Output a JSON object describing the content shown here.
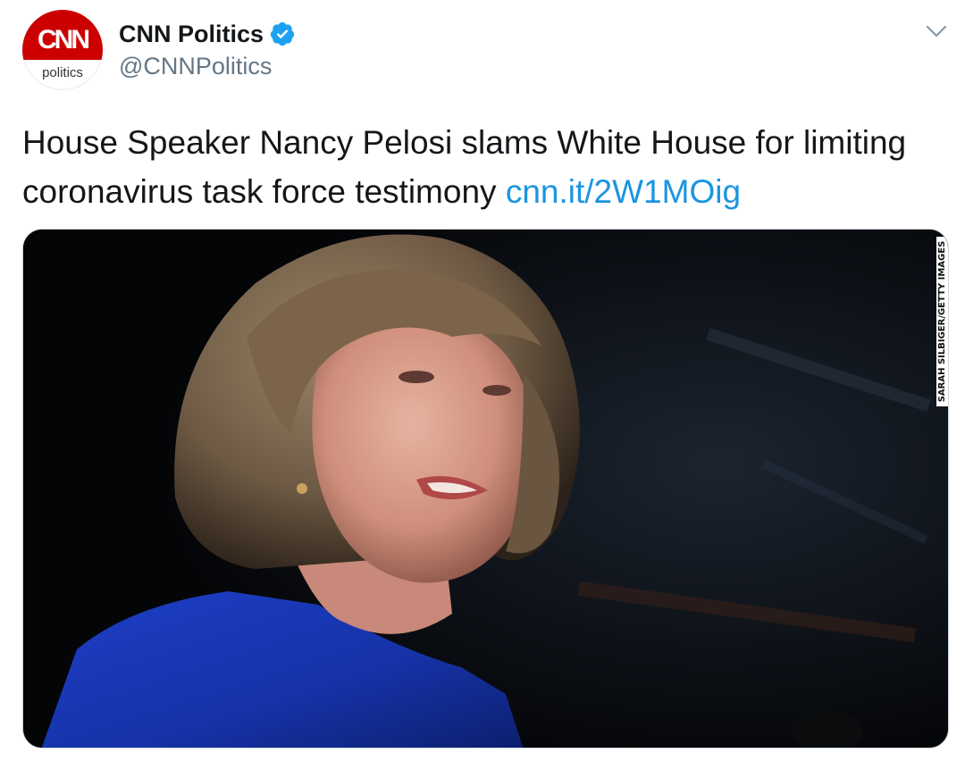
{
  "author": {
    "display_name": "CNN Politics",
    "handle": "@CNNPolitics",
    "verified": true,
    "avatar_logo": "CNN",
    "avatar_subtitle": "politics",
    "avatar_icon": "cnn-politics-logo"
  },
  "menu": {
    "icon": "chevron-down-icon"
  },
  "tweet": {
    "text": "House Speaker Nancy Pelosi slams White House for limiting coronavirus task force testimony ",
    "link_text": "cnn.it/2W1MOig"
  },
  "media": {
    "photo_credit": "SARAH SILBIGER/GETTY IMAGES"
  },
  "colors": {
    "link": "#1b95e0",
    "verified_badge": "#1da1f2",
    "secondary_text": "#657786",
    "cnn_red": "#cc0000"
  }
}
